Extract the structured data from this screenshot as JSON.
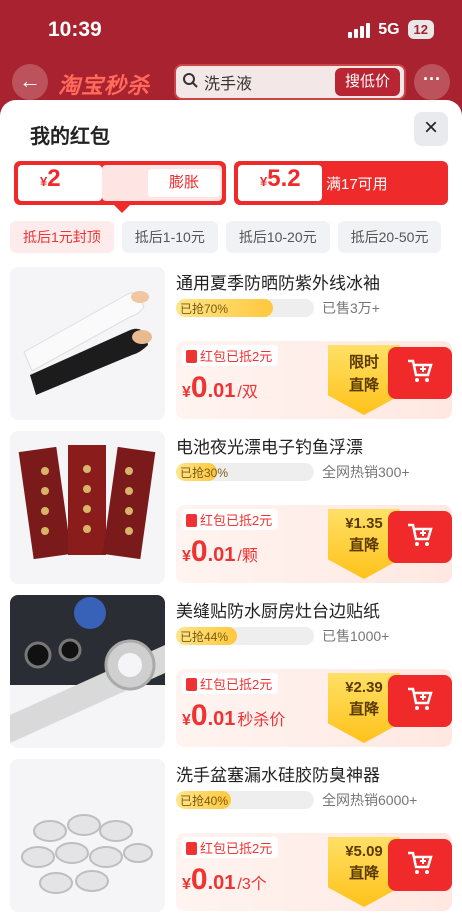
{
  "status": {
    "time": "10:39",
    "network": "5G",
    "battery": "12"
  },
  "header": {
    "brand": "淘宝秒杀",
    "search_text": "洗手液",
    "search_button": "搜低价",
    "more": "···",
    "back": "←"
  },
  "sheet": {
    "title": "我的红包",
    "close": "×",
    "coupons": [
      {
        "symbol": "¥",
        "amount": "2",
        "action": "膨胀"
      },
      {
        "symbol": "¥",
        "amount": "5.2",
        "condition": "满17可用"
      }
    ],
    "tabs": [
      "抵后1元封顶",
      "抵后1-10元",
      "抵后10-20元",
      "抵后20-50元"
    ]
  },
  "products": [
    {
      "title": "通用夏季防晒防紫外线冰袖",
      "grab": "已抢70%",
      "grab_percent": 70,
      "sold": "已售3万+",
      "redpack": "红包已抵2元",
      "yen": "¥",
      "price_int": "0",
      "price_dec": ".01",
      "unit": "/双",
      "badge_line1": "限时",
      "badge_line2": "直降"
    },
    {
      "title": "电池夜光漂电子钓鱼浮漂",
      "grab": "已抢30%",
      "grab_percent": 30,
      "sold": "全网热销300+",
      "redpack": "红包已抵2元",
      "yen": "¥",
      "price_int": "0",
      "price_dec": ".01",
      "unit": "/颗",
      "badge_line1": "¥1.35",
      "badge_line2": "直降"
    },
    {
      "title": "美缝贴防水厨房灶台边贴纸",
      "grab": "已抢44%",
      "grab_percent": 44,
      "sold": "已售1000+",
      "redpack": "红包已抵2元",
      "yen": "¥",
      "price_int": "0",
      "price_dec": ".01",
      "unit": "秒杀价",
      "badge_line1": "¥2.39",
      "badge_line2": "直降"
    },
    {
      "title": "洗手盆塞漏水硅胶防臭神器",
      "grab": "已抢40%",
      "grab_percent": 40,
      "sold": "全网热销6000+",
      "redpack": "红包已抵2元",
      "yen": "¥",
      "price_int": "0",
      "price_dec": ".01",
      "unit": "/3个",
      "badge_line1": "¥5.09",
      "badge_line2": "直降"
    }
  ],
  "colors": {
    "accent": "#ee2a2b",
    "header": "#a8222f",
    "badge": "#ffc21a"
  }
}
